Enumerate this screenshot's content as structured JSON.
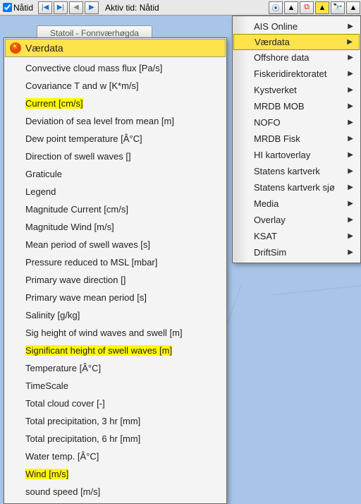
{
  "toolbar": {
    "natid_check_label": "Nåtid",
    "active_time_label": "Aktiv tid: Nåtid",
    "nav_first": "|◀",
    "nav_last": "▶|",
    "nav_prev": "◀",
    "nav_next": "▶"
  },
  "gray_button": "Statoil - Fonnværhøgda",
  "left_menu": {
    "header": "Værdata",
    "items": [
      {
        "label": "Convective cloud mass flux [Pa/s]",
        "hl": false
      },
      {
        "label": "Covariance T and w [K*m/s]",
        "hl": false
      },
      {
        "label": "Current [cm/s]",
        "hl": true
      },
      {
        "label": "Deviation of sea level from mean [m]",
        "hl": false
      },
      {
        "label": "Dew point temperature [Â°C]",
        "hl": false
      },
      {
        "label": "Direction of swell waves []",
        "hl": false
      },
      {
        "label": "Graticule",
        "hl": false
      },
      {
        "label": "Legend",
        "hl": false
      },
      {
        "label": "Magnitude Current [cm/s]",
        "hl": false
      },
      {
        "label": "Magnitude Wind [m/s]",
        "hl": false
      },
      {
        "label": "Mean period of swell waves [s]",
        "hl": false
      },
      {
        "label": "Pressure reduced to MSL [mbar]",
        "hl": false
      },
      {
        "label": "Primary wave direction []",
        "hl": false
      },
      {
        "label": "Primary wave mean period [s]",
        "hl": false
      },
      {
        "label": "Salinity [g/kg]",
        "hl": false
      },
      {
        "label": "Sig height of wind waves and swell [m]",
        "hl": false
      },
      {
        "label": "Significant height of swell waves [m]",
        "hl": true
      },
      {
        "label": "Temperature [Â°C]",
        "hl": false
      },
      {
        "label": "TimeScale",
        "hl": false
      },
      {
        "label": "Total cloud cover [-]",
        "hl": false
      },
      {
        "label": "Total precipitation, 3 hr [mm]",
        "hl": false
      },
      {
        "label": "Total precipitation, 6 hr [mm]",
        "hl": false
      },
      {
        "label": "Water temp. [Â°C]",
        "hl": false
      },
      {
        "label": "Wind [m/s]",
        "hl": true
      },
      {
        "label": "sound speed [m/s]",
        "hl": false
      }
    ]
  },
  "right_menu": {
    "items": [
      {
        "label": "AIS Online",
        "sel": false
      },
      {
        "label": "Værdata",
        "sel": true
      },
      {
        "label": "Offshore data",
        "sel": false
      },
      {
        "label": "Fiskeridirektoratet",
        "sel": false
      },
      {
        "label": "Kystverket",
        "sel": false
      },
      {
        "label": "MRDB MOB",
        "sel": false
      },
      {
        "label": "NOFO",
        "sel": false
      },
      {
        "label": "MRDB Fisk",
        "sel": false
      },
      {
        "label": "HI kartoverlay",
        "sel": false
      },
      {
        "label": "Statens kartverk",
        "sel": false
      },
      {
        "label": "Statens kartverk sjø",
        "sel": false
      },
      {
        "label": "Media",
        "sel": false
      },
      {
        "label": "Overlay",
        "sel": false
      },
      {
        "label": "KSAT",
        "sel": false
      },
      {
        "label": "DriftSim",
        "sel": false
      }
    ]
  },
  "icons": {
    "blue1": "⦿",
    "tri": "▲",
    "redsq": "⧉",
    "tri2": "▲",
    "binoc": "🔭",
    "tri3": "▲"
  }
}
